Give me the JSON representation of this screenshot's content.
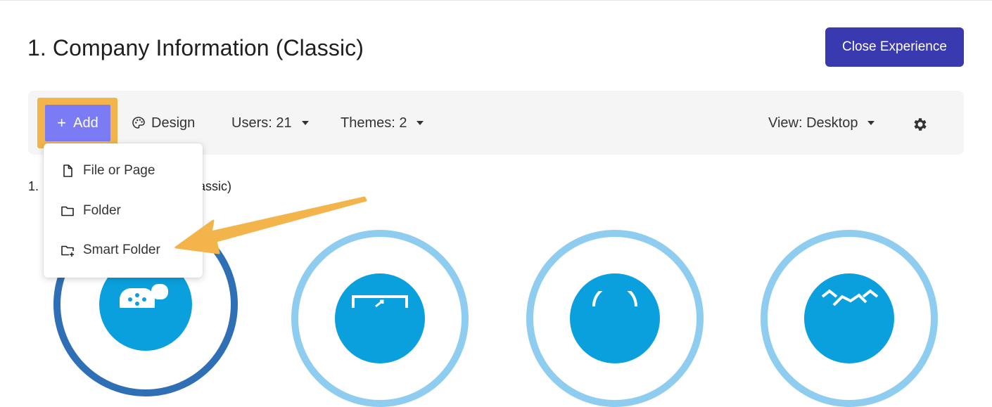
{
  "header": {
    "title": "1. Company Information (Classic)",
    "close_label": "Close Experience"
  },
  "toolbar": {
    "add_label": "Add",
    "add_plus": "+",
    "design_label": "Design",
    "users_label": "Users: 21",
    "themes_label": "Themes: 2",
    "view_label": "View: Desktop"
  },
  "add_menu": {
    "items": [
      {
        "label": "File or Page",
        "icon": "file-icon"
      },
      {
        "label": "Folder",
        "icon": "folder-icon"
      },
      {
        "label": "Smart Folder",
        "icon": "smart-folder-icon"
      }
    ]
  },
  "content": {
    "prefix": "1.",
    "suffix": "assic)"
  },
  "colors": {
    "close_button": "#3a3ab0",
    "add_button": "#7b7cf5",
    "highlight": "#f3b44b",
    "circle_blue": "#0aa0dd",
    "ring_light": "#8fcdf0",
    "ring_dark": "#2f6fb5"
  }
}
